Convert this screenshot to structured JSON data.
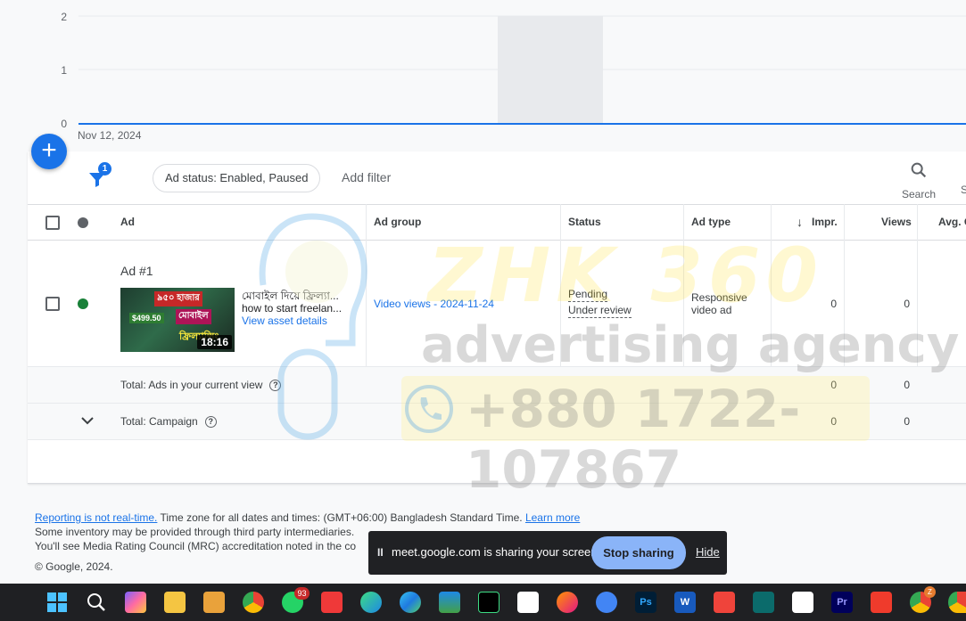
{
  "chart_data": {
    "type": "line",
    "x": [
      "Nov 12, 2024"
    ],
    "y_ticks": [
      "2",
      "1",
      "0"
    ],
    "ylim": [
      0,
      2
    ],
    "series": [
      {
        "values": [
          0
        ]
      }
    ],
    "highlight_band": true,
    "grid": true
  },
  "fab": {
    "label": "+"
  },
  "toolbar": {
    "filter_count": "1",
    "chip_label": "Ad status: Enabled, Paused",
    "add_filter_label": "Add filter",
    "search_label": "Search",
    "next_tool_label": "S"
  },
  "table": {
    "headers": {
      "ad": "Ad",
      "ad_group": "Ad group",
      "status": "Status",
      "ad_type": "Ad type",
      "sort_arrow": "↓",
      "impr": "Impr.",
      "views": "Views",
      "avg": "Avg. C"
    },
    "row": {
      "ad_name": "Ad #1",
      "headline": "মোবাইল দিয়ে ফ্রিল্যা...",
      "description": "how to start freelan...",
      "asset_link": "View asset details",
      "thumb_duration": "18:16",
      "thumb_text_1": "৯৫০ হাজার",
      "thumb_text_2": "$499.50",
      "thumb_text_3": "মোবাইল",
      "thumb_text_4": "ফ্রিল্যান্সিং",
      "ad_group_link": "Video views - 2024-11-24",
      "status_1": "Pending",
      "status_2": "Under review",
      "ad_type_1": "Responsive",
      "ad_type_2": "video ad",
      "impr": "0",
      "views": "0",
      "status_color": "#188038"
    },
    "total_view": {
      "label": "Total: Ads in your current view",
      "impr": "0",
      "views": "0"
    },
    "total_campaign": {
      "label": "Total: Campaign",
      "impr": "0",
      "views": "0"
    }
  },
  "watermark": {
    "title": "ZHK 360",
    "subtitle": "advertising agency",
    "phone": "+880 1722-107867"
  },
  "footer": {
    "link_realtime": "Reporting is not real-time.",
    "tz_text": " Time zone for all dates and times: (GMT+06:00) Bangladesh Standard Time. ",
    "learn_more": "Learn more",
    "line2": "Some inventory may be provided through third party intermediaries.",
    "line3": "You'll see Media Rating Council (MRC) accreditation noted in the co",
    "copyright": "© Google, 2024."
  },
  "sharebar": {
    "pause": "II",
    "message": "meet.google.com is sharing your screen.",
    "stop": "Stop sharing",
    "hide": "Hide"
  },
  "taskbar": {
    "whatsapp_badge": "93",
    "chrome_badge": "Z"
  },
  "colors": {
    "accent": "#1a73e8",
    "enabled_dot": "#188038"
  }
}
